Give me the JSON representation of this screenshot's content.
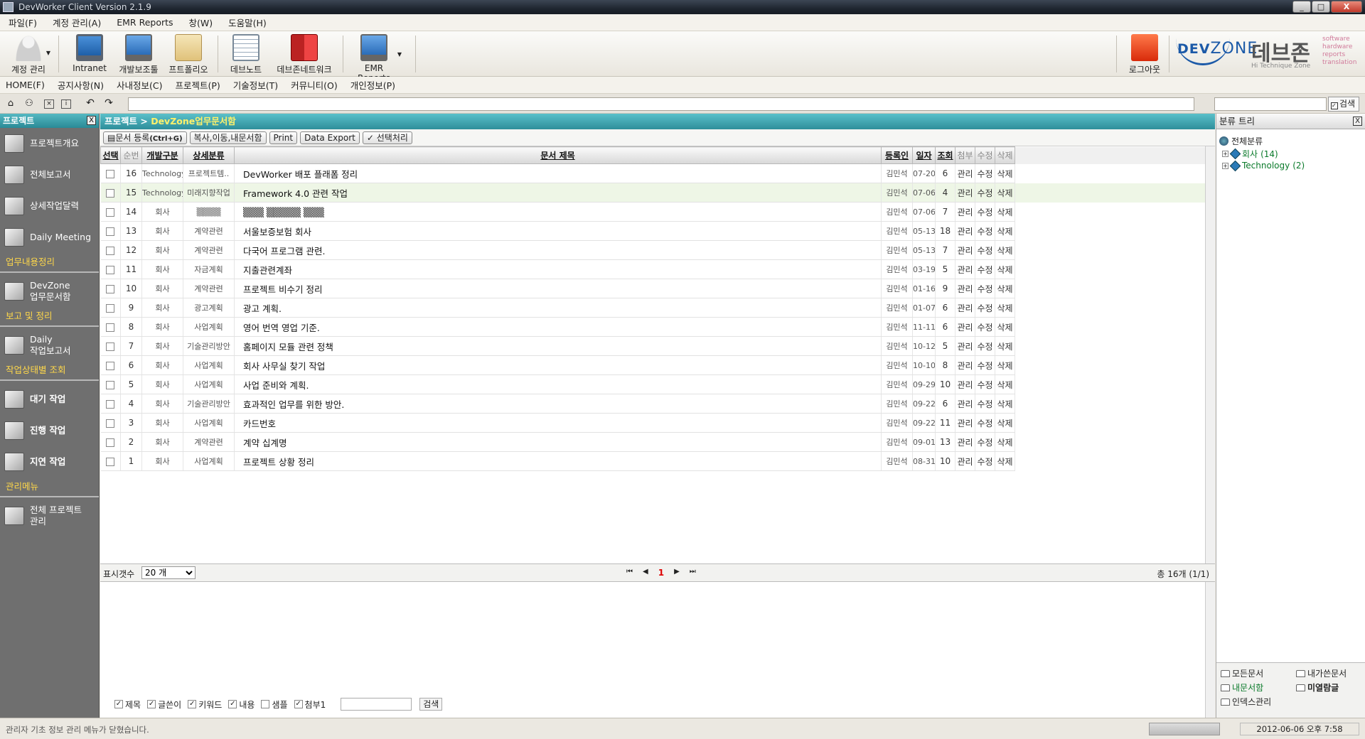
{
  "window": {
    "title": "DevWorker Client Version 2.1.9",
    "buttons": [
      "_",
      "□",
      "X"
    ]
  },
  "menubar": [
    "파일(F)",
    "계정 관리(A)",
    "EMR Reports",
    "창(W)",
    "도움말(H)"
  ],
  "toolbar": [
    {
      "label": "계정 관리",
      "icon": "user-icon"
    },
    {
      "label": "Intranet",
      "icon": "monitor-icon"
    },
    {
      "label": "개발보조툴",
      "icon": "computer-icon"
    },
    {
      "label": "프트폴리오",
      "icon": "portfolio-icon"
    },
    {
      "label": "데브노트",
      "icon": "note-icon"
    },
    {
      "label": "데브존네트워크",
      "icon": "books-icon"
    },
    {
      "label": "EMR Reports",
      "icon": "report-monitor-icon"
    }
  ],
  "logout": {
    "label": "로그아웃"
  },
  "brand": {
    "dev": "DEV",
    "zone": "ZONE",
    "korean": "데브존",
    "tagline": "Hi Technique Zone",
    "side": [
      "software",
      "hardware",
      "reports",
      "translation"
    ]
  },
  "menubar2": [
    "HOME(F)",
    "공지사항(N)",
    "사내정보(C)",
    "프로젝트(P)",
    "기술정보(T)",
    "커뮤니티(O)",
    "개인정보(P)"
  ],
  "search": {
    "button": "검색",
    "check": "✓"
  },
  "left_panel": {
    "title": "프로젝트",
    "close": "X",
    "items_top": [
      "프로젝트개요",
      "전체보고서",
      "상세작업달력",
      "Daily Meeting"
    ],
    "sections": [
      {
        "title": "업무내용정리",
        "items": [
          "DevZone\n업무문서함"
        ]
      },
      {
        "title": "보고 및 정리",
        "items": [
          "Daily\n작업보고서"
        ]
      },
      {
        "title": "작업상태별 조회",
        "items": [
          "대기 작업",
          "진행 작업",
          "지연 작업"
        ]
      },
      {
        "title": "관리메뉴",
        "items": [
          "전체 프로젝트\n관리"
        ]
      }
    ]
  },
  "breadcrumb": {
    "root": "프로젝트 >",
    "current": "DevZone업무문서함"
  },
  "actions": {
    "register": "문서 등록",
    "register_key": "(Ctrl+G)",
    "copy": "복사,이동,내문서함",
    "print": "Print",
    "export": "Data Export",
    "select": "선택처리",
    "select_check": "✓",
    "doc_glyph": "▤"
  },
  "table": {
    "headers": [
      "선택",
      "순번",
      "개발구분",
      "상세분류",
      "문서 제목",
      "등록인",
      "일자",
      "조회",
      "첨부",
      "수정",
      "삭제"
    ],
    "action_labels": {
      "manage": "관리",
      "edit": "수정",
      "delete": "삭제"
    },
    "rows": [
      {
        "no": "16",
        "dev": "Technology",
        "cat": "프로젝트템..",
        "title": "DevWorker 배포 플래폼 정리",
        "author": "김민석",
        "date": "07-20",
        "views": "6"
      },
      {
        "no": "15",
        "dev": "Technology",
        "cat": "미래지향작업",
        "title": "Framework 4.0 관련 작업",
        "author": "김민석",
        "date": "07-06",
        "views": "4"
      },
      {
        "no": "14",
        "dev": "회사",
        "cat": "▒▒▒▒",
        "title": "▒▒▒ ▒▒▒▒▒ ▒▒▒",
        "author": "김민석",
        "date": "07-06",
        "views": "7"
      },
      {
        "no": "13",
        "dev": "회사",
        "cat": "계약관련",
        "title": "서울보증보험 회사",
        "author": "김민석",
        "date": "05-13",
        "views": "18"
      },
      {
        "no": "12",
        "dev": "회사",
        "cat": "계약관련",
        "title": "다국어 프로그램 관련.",
        "author": "김민석",
        "date": "05-13",
        "views": "7"
      },
      {
        "no": "11",
        "dev": "회사",
        "cat": "자금계획",
        "title": "지출관련계좌",
        "author": "김민석",
        "date": "03-19",
        "views": "5"
      },
      {
        "no": "10",
        "dev": "회사",
        "cat": "계약관련",
        "title": "프로젝트 비수기 정리",
        "author": "김민석",
        "date": "01-16",
        "views": "9"
      },
      {
        "no": "9",
        "dev": "회사",
        "cat": "광고계획",
        "title": "광고 계획.",
        "author": "김민석",
        "date": "01-07",
        "views": "6"
      },
      {
        "no": "8",
        "dev": "회사",
        "cat": "사업계획",
        "title": "영어 번역 영업 기준.",
        "author": "김민석",
        "date": "11-11",
        "views": "6"
      },
      {
        "no": "7",
        "dev": "회사",
        "cat": "기술관리방안",
        "title": "홈페이지 모듈 관련 정책",
        "author": "김민석",
        "date": "10-12",
        "views": "5"
      },
      {
        "no": "6",
        "dev": "회사",
        "cat": "사업계획",
        "title": "회사 사무실 찾기 작업",
        "author": "김민석",
        "date": "10-10",
        "views": "8"
      },
      {
        "no": "5",
        "dev": "회사",
        "cat": "사업계획",
        "title": "사업 준비와 계획.",
        "author": "김민석",
        "date": "09-29",
        "views": "10"
      },
      {
        "no": "4",
        "dev": "회사",
        "cat": "기술관리방안",
        "title": "효과적인 업무를 위한 방안.",
        "author": "김민석",
        "date": "09-22",
        "views": "6"
      },
      {
        "no": "3",
        "dev": "회사",
        "cat": "사업계획",
        "title": "카드번호",
        "author": "김민석",
        "date": "09-22",
        "views": "11"
      },
      {
        "no": "2",
        "dev": "회사",
        "cat": "계약관련",
        "title": "계약 십계명",
        "author": "김민석",
        "date": "09-01",
        "views": "13"
      },
      {
        "no": "1",
        "dev": "회사",
        "cat": "사업계획",
        "title": "프로젝트 상황 정리",
        "author": "김민석",
        "date": "08-31",
        "views": "10"
      }
    ]
  },
  "pager": {
    "label": "표시갯수",
    "page_size": "20 개",
    "page": "1",
    "first": "⏮",
    "prev": "◀",
    "next": "▶",
    "last": "⏭",
    "total": "총 16개 (1/1)"
  },
  "filters": {
    "items": [
      {
        "label": "제목",
        "checked": true
      },
      {
        "label": "글쓴이",
        "checked": true
      },
      {
        "label": "키워드",
        "checked": true
      },
      {
        "label": "내용",
        "checked": true
      },
      {
        "label": "샘플",
        "checked": false
      },
      {
        "label": "첨부1",
        "checked": true
      }
    ],
    "button": "검색"
  },
  "right_panel": {
    "title": "분류 트리",
    "close": "X",
    "root": "전체분류",
    "nodes": [
      {
        "label": "회사",
        "count": "(14)"
      },
      {
        "label": "Technology",
        "count": "(2)"
      }
    ],
    "expander": "+",
    "folders": [
      "모든문서",
      "내가쓴문서",
      "내문서함",
      "미열람글",
      "인덱스관리"
    ]
  },
  "status": {
    "message": "관리자 기초 정보 관리 메뉴가 닫혔습니다.",
    "datetime": "2012-06-06 오후 7:58"
  },
  "colors": {
    "accent_teal": "#2e8e9a",
    "section_yellow": "#ffd84a",
    "tree_green": "#0a7a2a",
    "highlight_row": "#eef6e6"
  }
}
